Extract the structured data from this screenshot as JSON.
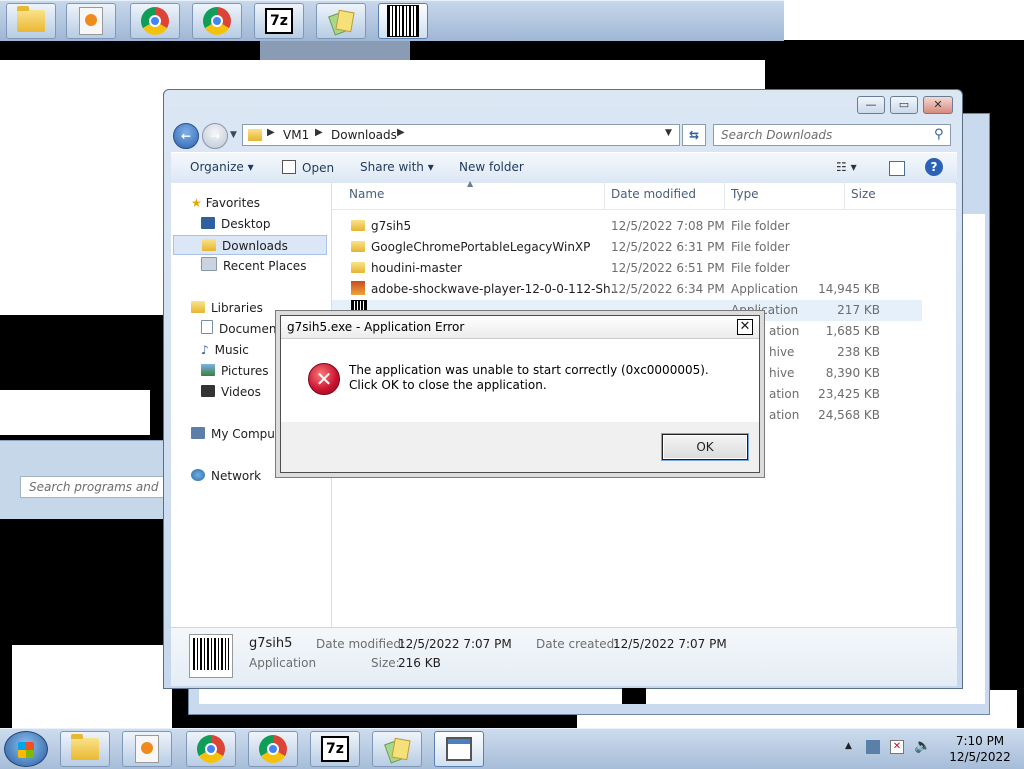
{
  "top_taskbar": {
    "items": [
      {
        "name": "explorer",
        "icon": "folder-icon"
      },
      {
        "name": "media",
        "icon": "media-player-icon"
      },
      {
        "name": "chrome1",
        "icon": "chrome-icon"
      },
      {
        "name": "chrome2",
        "icon": "chrome-icon"
      },
      {
        "name": "7zip",
        "icon": "7zip-icon",
        "label": "7z"
      },
      {
        "name": "pages",
        "icon": "pages-icon"
      },
      {
        "name": "barcode",
        "icon": "barcode-app-icon"
      }
    ]
  },
  "start_search": {
    "placeholder": "Search programs and files"
  },
  "explorer": {
    "address": {
      "segments": [
        "VM1",
        "Downloads"
      ]
    },
    "search": {
      "placeholder": "Search Downloads"
    },
    "toolbar": {
      "organize": "Organize",
      "open": "Open",
      "share_with": "Share with",
      "new_folder": "New folder"
    },
    "nav": {
      "favorites": "Favorites",
      "desktop": "Desktop",
      "downloads": "Downloads",
      "recent_places": "Recent Places",
      "libraries": "Libraries",
      "documents": "Documen",
      "music": "Music",
      "pictures": "Pictures",
      "videos": "Videos",
      "my_computer": "My Comput",
      "network": "Network"
    },
    "columns": {
      "name": "Name",
      "date_modified": "Date modified",
      "type": "Type",
      "size": "Size"
    },
    "rows": [
      {
        "name": "g7sih5",
        "date": "12/5/2022 7:08 PM",
        "type": "File folder",
        "size": ""
      },
      {
        "name": "GoogleChromePortableLegacyWinXP",
        "date": "12/5/2022 6:31 PM",
        "type": "File folder",
        "size": ""
      },
      {
        "name": "houdini-master",
        "date": "12/5/2022 6:51 PM",
        "type": "File folder",
        "size": ""
      },
      {
        "name": "adobe-shockwave-player-12-0-0-112-Sh...",
        "date": "12/5/2022 6:34 PM",
        "type": "Application",
        "size": "14,945 KB"
      },
      {
        "name": "",
        "date": "",
        "type": "Application",
        "size": "217 KB"
      },
      {
        "name": "",
        "date": "",
        "type": "ation",
        "size": "1,685 KB"
      },
      {
        "name": "",
        "date": "",
        "type": "hive",
        "size": "238 KB"
      },
      {
        "name": "",
        "date": "",
        "type": "hive",
        "size": "8,390 KB"
      },
      {
        "name": "",
        "date": "",
        "type": "ation",
        "size": "23,425 KB"
      },
      {
        "name": "",
        "date": "",
        "type": "ation",
        "size": "24,568 KB"
      }
    ],
    "details": {
      "file_name": "g7sih5",
      "file_type": "Application",
      "date_modified_label": "Date modified:",
      "date_modified_value": "12/5/2022 7:07 PM",
      "date_created_label": "Date created:",
      "date_created_value": "12/5/2022 7:07 PM",
      "size_label": "Size:",
      "size_value": "216 KB"
    }
  },
  "dialog": {
    "title": "g7sih5.exe - Application Error",
    "message": "The application was unable to start correctly (0xc0000005). Click OK to close the application.",
    "ok_label": "OK",
    "close_glyph": "✕"
  },
  "bottom_taskbar": {
    "clock_time": "7:10 PM",
    "clock_date": "12/5/2022"
  },
  "colors": {
    "accent": "#3a6ea5",
    "error": "#c8102e",
    "selection": "#e5f0fb"
  }
}
